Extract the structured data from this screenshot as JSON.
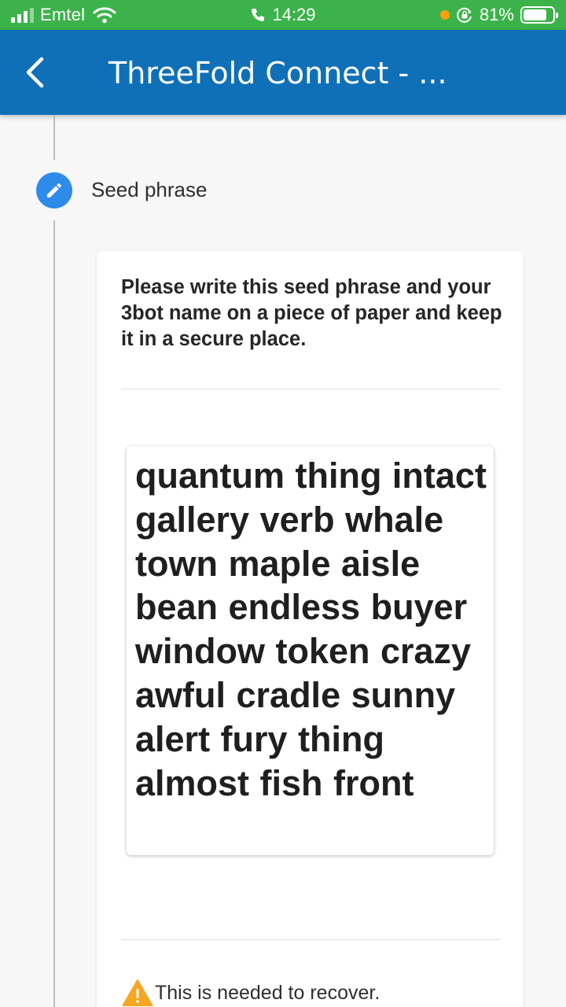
{
  "status_bar": {
    "carrier": "Emtel",
    "time": "14:29",
    "battery": "81%",
    "battery_level": 0.81,
    "bg_color": "#3cb34a",
    "icons": [
      "signal-icon",
      "wifi-icon",
      "phone-icon",
      "orientation-lock-icon",
      "battery-icon"
    ]
  },
  "app_bar": {
    "title": "ThreeFold Connect - ...",
    "bg_color": "#0f70b8",
    "back_icon": "chevron-left-icon"
  },
  "step": {
    "icon": "pencil-icon",
    "label": "Seed phrase",
    "icon_color": "#2f8be9"
  },
  "card": {
    "instruction": "Please write this seed phrase and your 3bot name on a piece of paper and keep it in a secure place.",
    "seed_phrase": "quantum thing intact gallery verb whale town maple aisle bean endless buyer window token crazy awful cradle sunny alert fury thing almost fish front",
    "warning_icon": "warning-icon",
    "warning_text": "This is needed to recover."
  }
}
